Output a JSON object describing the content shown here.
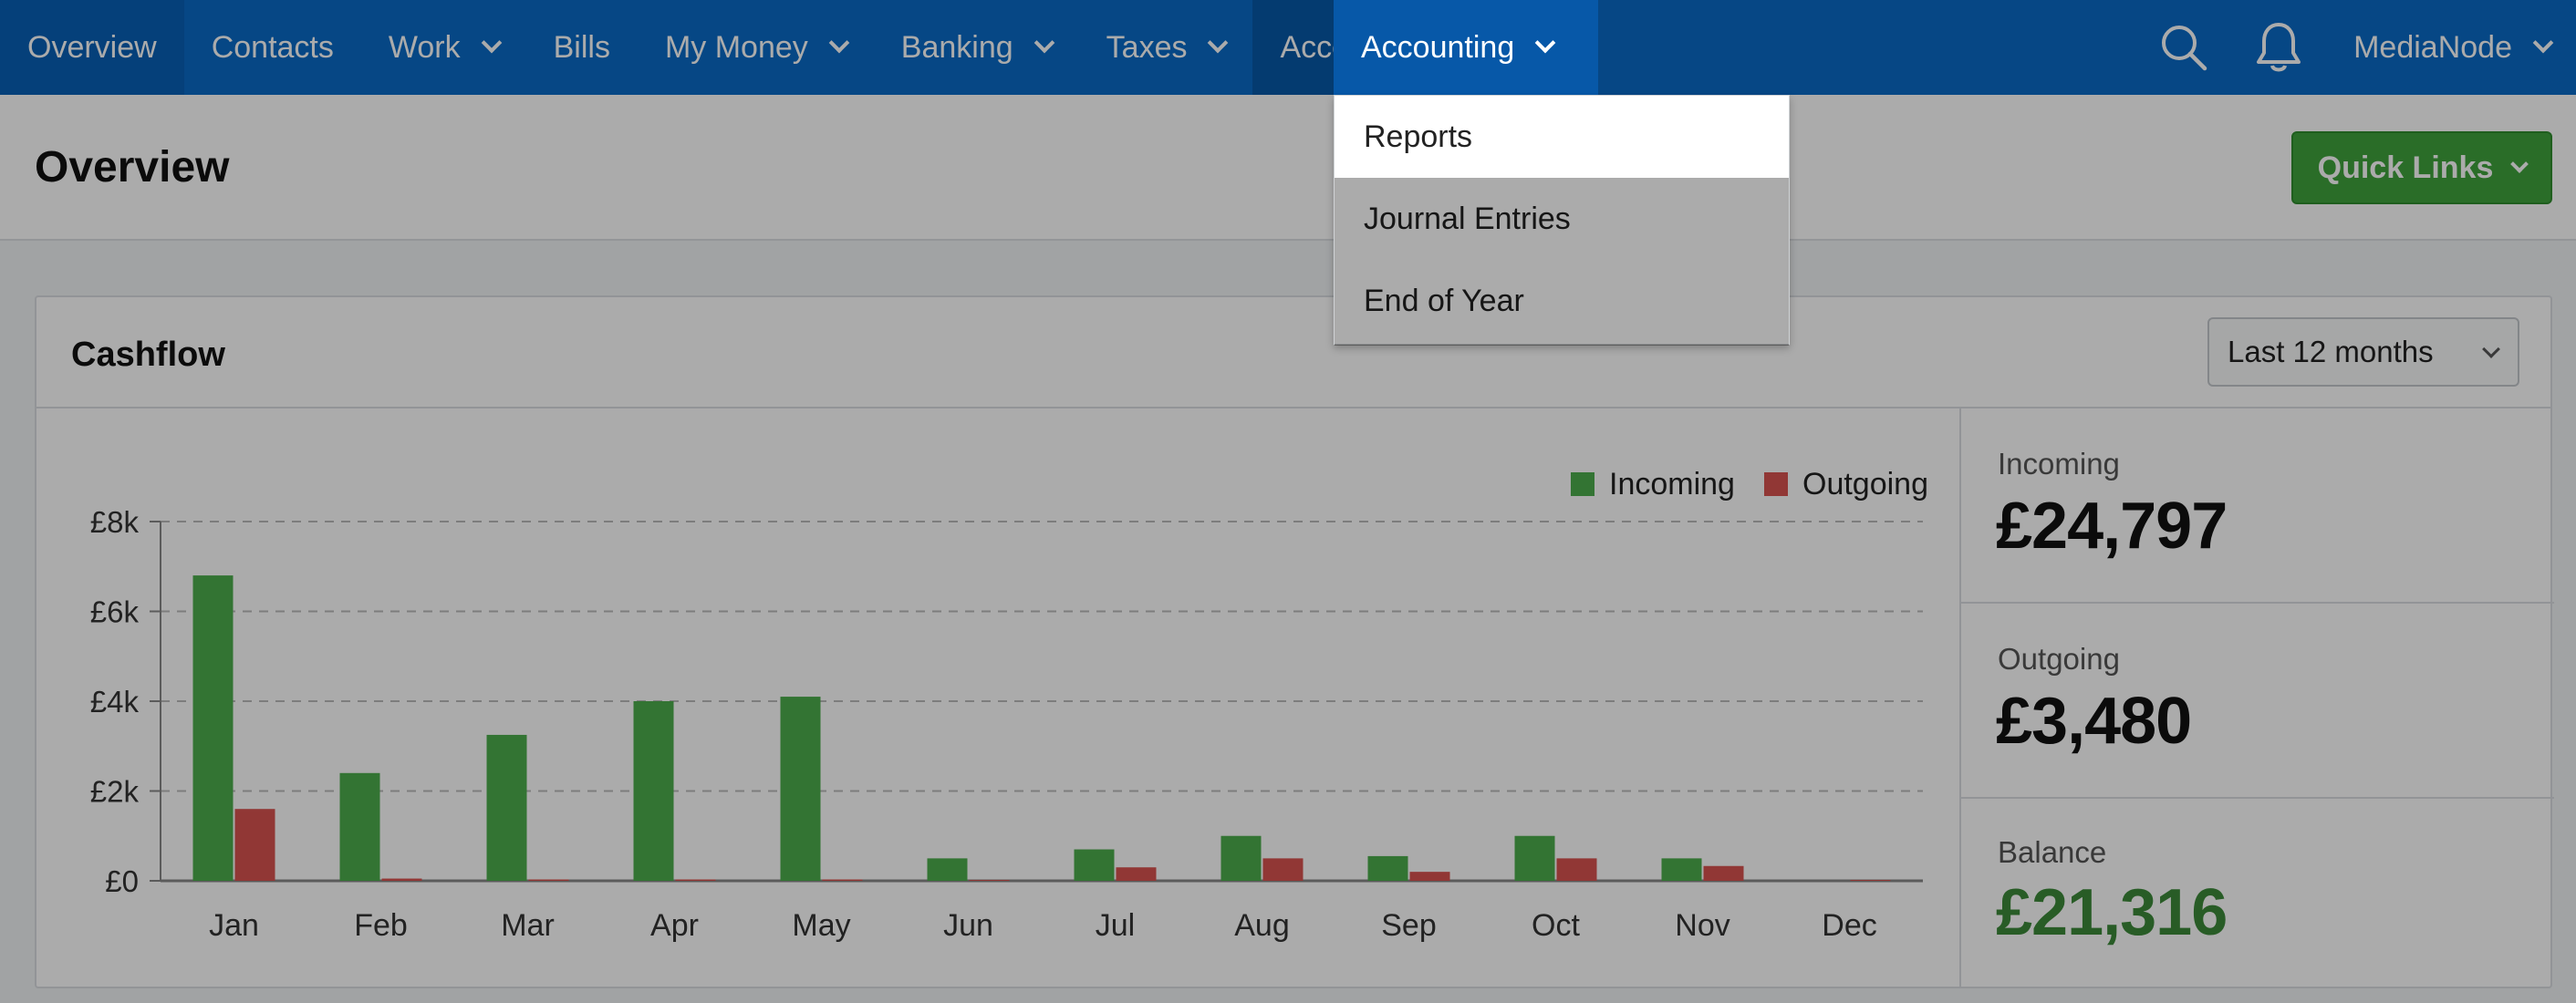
{
  "nav": {
    "items": [
      {
        "label": "Overview",
        "has_dropdown": false
      },
      {
        "label": "Contacts",
        "has_dropdown": false
      },
      {
        "label": "Work",
        "has_dropdown": true
      },
      {
        "label": "Bills",
        "has_dropdown": false
      },
      {
        "label": "My Money",
        "has_dropdown": true
      },
      {
        "label": "Banking",
        "has_dropdown": true
      },
      {
        "label": "Taxes",
        "has_dropdown": true
      },
      {
        "label": "Accounting",
        "has_dropdown": true
      }
    ],
    "user": "MediaNode",
    "search_icon": "search-icon",
    "bell_icon": "bell-icon"
  },
  "header": {
    "title": "Overview",
    "quick_links": "Quick Links"
  },
  "dropdown": {
    "items": [
      "Reports",
      "Journal Entries",
      "End of Year"
    ],
    "highlighted": "Reports"
  },
  "cashflow": {
    "title": "Cashflow",
    "range": "Last 12 months",
    "stats": {
      "incoming_label": "Incoming",
      "incoming_value": "£24,797",
      "outgoing_label": "Outgoing",
      "outgoing_value": "£3,480",
      "balance_label": "Balance",
      "balance_value": "£21,316"
    }
  },
  "colors": {
    "nav": "#0a6bc6",
    "incoming": "#4cae4c",
    "outgoing": "#d9534f",
    "balance": "#3c8a3a",
    "quick_links": "#3fa33d"
  },
  "chart_data": {
    "type": "bar",
    "categories": [
      "Jan",
      "Feb",
      "Mar",
      "Apr",
      "May",
      "Jun",
      "Jul",
      "Aug",
      "Sep",
      "Oct",
      "Nov",
      "Dec"
    ],
    "series": [
      {
        "name": "Incoming",
        "values": [
          6800,
          2400,
          3250,
          4000,
          4100,
          500,
          700,
          1000,
          550,
          1000,
          500,
          0
        ]
      },
      {
        "name": "Outgoing",
        "values": [
          1600,
          50,
          30,
          30,
          30,
          20,
          300,
          500,
          200,
          500,
          330,
          20
        ]
      }
    ],
    "yticks": [
      "£0",
      "£2k",
      "£4k",
      "£6k",
      "£8k"
    ],
    "ylim": [
      0,
      8000
    ],
    "legend": "top-right",
    "grid": true
  }
}
